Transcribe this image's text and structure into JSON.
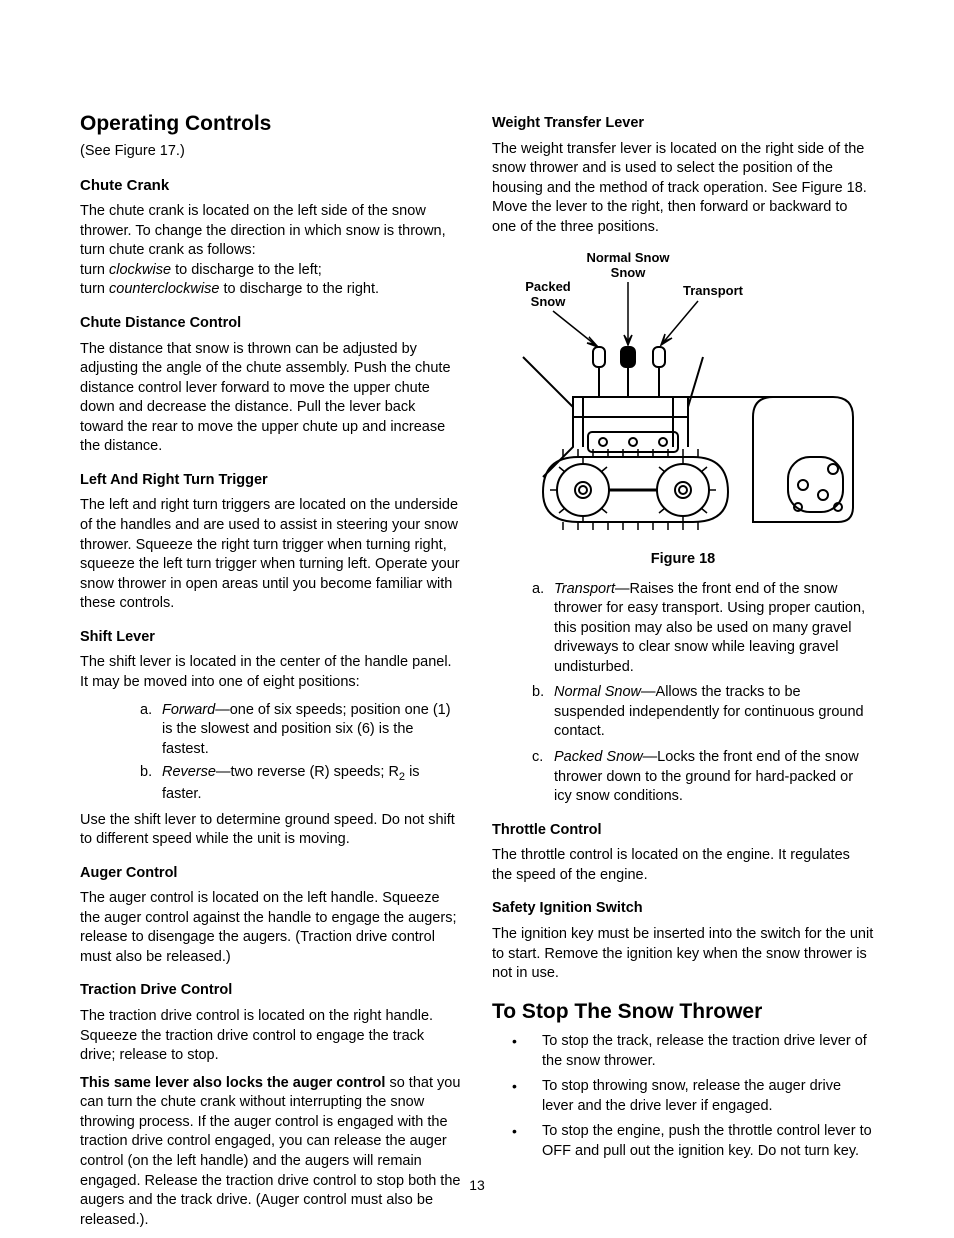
{
  "page_number": "13",
  "left": {
    "h1": "Operating Controls",
    "see": "(See Figure 17.)",
    "chute_crank_h": "Chute Crank",
    "chute_crank_p1": "The chute crank is located on the left side of the snow thrower. To change the direction in which snow is thrown, turn chute crank as follows:",
    "chute_crank_l1a": "turn ",
    "chute_crank_l1b": "clockwise",
    "chute_crank_l1c": " to discharge to the left;",
    "chute_crank_l2a": "turn ",
    "chute_crank_l2b": "counterclockwise",
    "chute_crank_l2c": " to discharge to the right.",
    "dist_h": "Chute Distance Control",
    "dist_p": "The distance that snow is thrown can be adjusted by adjusting the angle of the chute assembly. Push the chute distance control lever forward to move the upper chute down and decrease the distance. Pull the lever back toward the rear to move the upper chute up and increase the distance.",
    "trig_h": "Left And Right Turn Trigger",
    "trig_p": "The left and right turn triggers are located on the underside of the handles and are used to assist in steering your snow thrower. Squeeze the right turn trigger when turning right, squeeze the left turn trigger when turning left. Operate your snow thrower in open areas until you become familiar with these controls.",
    "shift_h": "Shift Lever",
    "shift_p1": "The shift lever is located in the center of the handle panel. It may be moved into one of eight positions:",
    "shift_a_m": "a.",
    "shift_a_i": "Forward",
    "shift_a_t": "—one of six speeds; position one (1) is the slowest  and position six (6) is the fastest.",
    "shift_b_m": "b.",
    "shift_b_i": "Reverse",
    "shift_b_t1": "—two reverse (R) speeds; R",
    "shift_b_sub": "2",
    "shift_b_t2": " is faster.",
    "shift_p2": "Use the shift lever to determine ground speed. Do not shift to different speed while the unit is moving.",
    "aug_h": "Auger Control",
    "aug_p": "The auger control is located on the left handle. Squeeze the auger control against the handle to engage the augers; release to disengage the augers. (Traction drive control must also be released.)",
    "trac_h": "Traction Drive Control",
    "trac_p1": "The traction drive control is located on the right handle. Squeeze the traction drive control to engage the track drive; release to stop.",
    "trac_p2_bold": "This same lever also locks the auger control",
    "trac_p2_rest": " so that you can turn the chute crank without interrupting the snow throwing process. If the auger control is engaged with the traction drive control engaged, you can release the auger control (on the left handle) and the augers will remain engaged. Release the traction drive control to stop both the augers and the track drive. (Auger control must also be released.)."
  },
  "right": {
    "wtl_h": "Weight Transfer Lever",
    "wtl_p": "The weight transfer lever is located on the right side of the snow thrower and is used to select the position of the housing and the method of track operation. See Figure 18. Move the lever to the right, then forward or backward to one of the three positions.",
    "fig_label_normal": "Normal Snow",
    "fig_label_packed": "Packed Snow",
    "fig_label_transport": "Transport",
    "fig_caption": "Figure 18",
    "pos_a_m": "a.",
    "pos_a_i": "Transport",
    "pos_a_t": "—Raises the front end of the snow thrower for easy transport. Using proper caution, this position may also be used on many gravel driveways to clear snow while leaving gravel undisturbed.",
    "pos_b_m": "b.",
    "pos_b_i": "Normal Snow",
    "pos_b_t": "—Allows the tracks to be suspended independently for continuous ground contact.",
    "pos_c_m": "c.",
    "pos_c_i": "Packed Snow",
    "pos_c_t": "—Locks the front end of the snow thrower down to the ground for hard-packed or icy snow conditions.",
    "thr_h": "Throttle Control",
    "thr_p": "The throttle control is located on the engine. It regulates the speed of the engine.",
    "ign_h": "Safety Ignition Switch",
    "ign_p": "The ignition key must be inserted into the switch for the unit to start. Remove the ignition key when the snow thrower is not in use.",
    "stop_h1": "To Stop The Snow Thrower",
    "stop_b1": "To stop the track, release the traction drive lever of the snow thrower.",
    "stop_b2": "To stop throwing snow, release the auger drive lever and the drive lever if engaged.",
    "stop_b3": "To stop the engine, push the throttle control lever to OFF and pull out the ignition key. Do not turn key."
  }
}
